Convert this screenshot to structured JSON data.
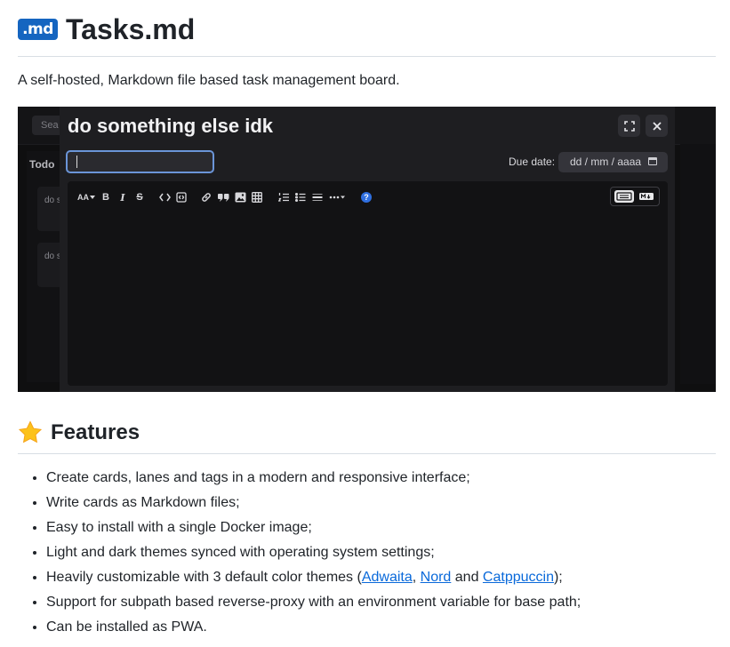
{
  "header": {
    "logo_text": ".md",
    "title": "Tasks.md",
    "description": "A self-hosted, Markdown file based task management board."
  },
  "screenshot": {
    "background": {
      "search_placeholder": "Sea",
      "lane_title": "Todo",
      "card_1": "do s",
      "card_2": "do s"
    },
    "modal": {
      "card_title": "do something else idk",
      "tag_input_value": "",
      "due_date_label": "Due date:",
      "due_date_placeholder": "dd / mm / aaaa",
      "toolbar": {
        "heading_label": "AA",
        "bold_label": "B",
        "italic_label": "I",
        "strike_label": "S",
        "help_label": "?"
      }
    }
  },
  "features": {
    "icon": "star-icon",
    "title": "Features",
    "items": [
      {
        "text": "Create cards, lanes and tags in a modern and responsive interface;"
      },
      {
        "text": "Write cards as Markdown files;"
      },
      {
        "text": "Easy to install with a single Docker image;"
      },
      {
        "text": "Light and dark themes synced with operating system settings;"
      },
      {
        "text_before": "Heavily customizable with 3 default color themes (",
        "link1": "Adwaita",
        "sep1": ", ",
        "link2": "Nord",
        "sep2": " and ",
        "link3": "Catppuccin",
        "text_after": ");"
      },
      {
        "text": "Support for subpath based reverse-proxy with an environment variable for base path;"
      },
      {
        "text": "Can be installed as PWA."
      }
    ]
  },
  "colors": {
    "logo_bg": "#1565c0",
    "link": "#0969da",
    "modal_bg": "#1e1e21",
    "focus_ring": "#6b95d8"
  }
}
